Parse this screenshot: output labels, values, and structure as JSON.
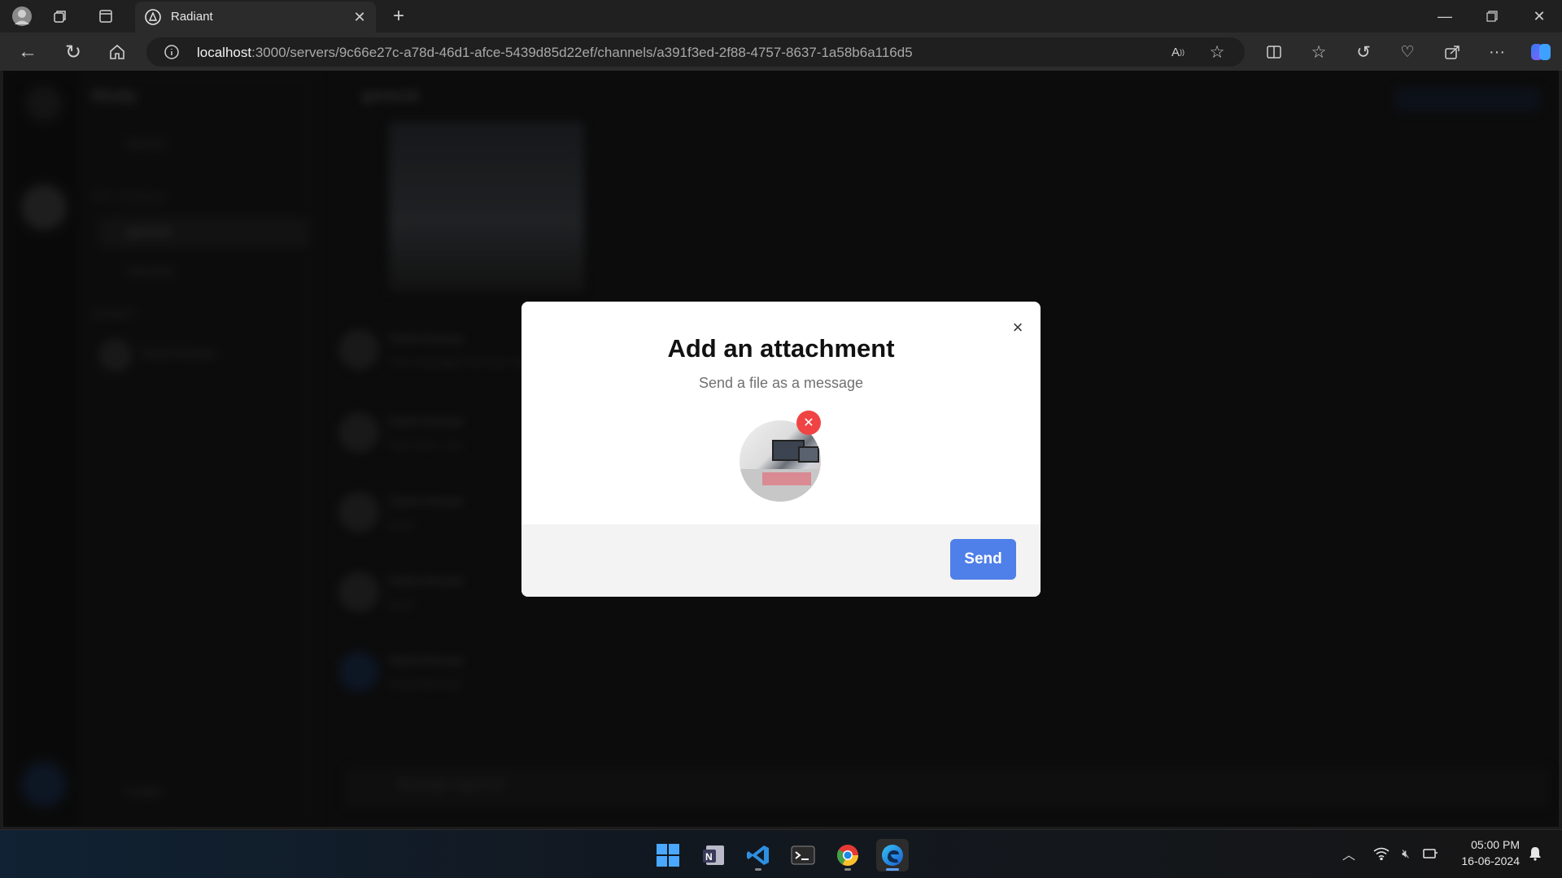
{
  "browser": {
    "tab_title": "Radiant",
    "url_host": "localhost",
    "url_rest": ":3000/servers/9c66e27c-a78d-46d1-afce-5439d85d22ef/channels/a391f3ed-2f88-4757-8637-1a58b6a116d5",
    "icons": [
      "profile-avatar-icon",
      "workspaces-icon",
      "tab-actions-icon",
      "radiant-favicon",
      "close-tab-icon",
      "new-tab-icon",
      "back-icon",
      "refresh-icon",
      "home-icon",
      "site-info-icon",
      "read-aloud-icon",
      "favorite-star-icon",
      "split-screen-icon",
      "favorites-icon",
      "history-icon",
      "browser-essentials-icon",
      "share-icon",
      "more-icon",
      "copilot-icon",
      "minimize-icon",
      "restore-icon",
      "close-window-icon"
    ]
  },
  "background_app": {
    "server_name": "Study",
    "channel_name": "general",
    "sidebar": {
      "search": "Search",
      "text_channels_header": "TEXT CHANNELS",
      "channels": [
        "general",
        "learning"
      ],
      "members_header": "MEMBERS",
      "member": "Rahil Ahmad"
    },
    "messages": [
      {
        "author": "Rahil Ahmad",
        "text": "This message has been deleted."
      },
      {
        "author": "Rahil Ahmad",
        "text": "Hey, how r you"
      },
      {
        "author": "Rahil Ahmad",
        "text": "good"
      },
      {
        "author": "Rahil Ahmad",
        "text": "good"
      },
      {
        "author": "Rahil Ahmad",
        "text": "Good Morning"
      }
    ],
    "input_placeholder": "Message #general",
    "user_label": "Profile",
    "top_right_button": "Live chat from updates"
  },
  "modal": {
    "title": "Add an attachment",
    "subtitle": "Send a file as a message",
    "send_label": "Send",
    "close_symbol": "×",
    "remove_symbol": "✕"
  },
  "taskbar": {
    "apps": [
      "windows-start-icon",
      "onenote-icon",
      "vscode-icon",
      "terminal-icon",
      "chrome-icon",
      "edge-icon"
    ],
    "time": "05:00 PM",
    "date": "16-06-2024"
  },
  "colors": {
    "accent": "#4f7fe8",
    "danger": "#f04444",
    "page_bg": "#161616"
  }
}
